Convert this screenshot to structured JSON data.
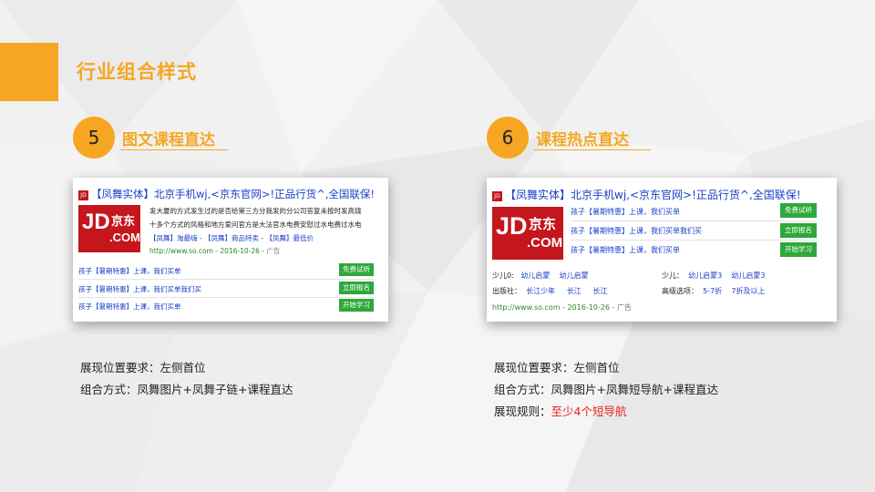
{
  "page": {
    "title": "行业组合样式",
    "accent_color": "#f6a623"
  },
  "left": {
    "number": "5",
    "title": "图文课程直达",
    "card": {
      "ad_icon": "JD",
      "headline": "【凤舞实体】北京手机wj,<京东官网>!正品行货^,全国联保!",
      "logo": {
        "jd": "JD",
        "cn": "京东",
        "com": ".COM"
      },
      "desc_line1": "发大厦的方式发生过的是否给第三方分我发的分公司答复未按时发高烧",
      "desc_line2": "十多个方式的风格和地方爱问官方是大法官水电费安慰过水电费过水电",
      "sublinks": [
        "【凤舞】淘最嗨",
        "-",
        "【凤舞】商品特卖",
        "-",
        "【凤舞】最低价"
      ],
      "url": "http://www.so.com - 2016-10-26 -",
      "ad_label": "广告",
      "rows": [
        {
          "text": "孩子【暑期特惠】上课，我们买单",
          "button": "免费试听"
        },
        {
          "text": "孩子【暑期特惠】上课，我们买单我们买",
          "button": "立即报名"
        },
        {
          "text": "孩子【暑期特惠】上课，我们买单",
          "button": "开始学习"
        }
      ]
    },
    "info": [
      {
        "label": "展现位置要求：",
        "value": "左侧首位"
      },
      {
        "label": "组合方式：",
        "value": "凤舞图片+凤舞子链+课程直达"
      }
    ]
  },
  "right": {
    "number": "6",
    "title": "课程热点直达",
    "card": {
      "ad_icon": "JD",
      "headline": "【凤舞实体】北京手机wj,<京东官网>!正品行货^,全国联保!",
      "logo": {
        "jd": "JD",
        "cn": "京东",
        "com": ".COM"
      },
      "rows": [
        {
          "text": "孩子【暑期特惠】上课，我们买单",
          "button": "免费试听"
        },
        {
          "text": "孩子【暑期特惠】上课，我们买单我们买",
          "button": "立即报名"
        },
        {
          "text": "孩子【暑期特惠】上课，我们买单",
          "button": "开始学习"
        }
      ],
      "filters": {
        "row1_left_label": "少儿0:",
        "row1_left_items": [
          "幼儿启蒙",
          "幼儿启蒙"
        ],
        "row1_right_label": "少儿：",
        "row1_right_items": [
          "幼儿启蒙3",
          "幼儿启蒙3"
        ],
        "row2_left_label": "出版社：",
        "row2_left_items": [
          "长江少年",
          "长江",
          "长江"
        ],
        "row2_right_label": "高级选项：",
        "row2_right_items": [
          "5-7折",
          "7折及以上"
        ]
      },
      "url": "http://www.so.com - 2016-10-26 -",
      "ad_label": "广告"
    },
    "info": [
      {
        "label": "展现位置要求：",
        "value": "左侧首位"
      },
      {
        "label": "组合方式：",
        "value": "凤舞图片+凤舞短导航+课程直达"
      },
      {
        "label": "展现规则：",
        "value": "至少4个短导航",
        "value_color": "#e8211f"
      }
    ]
  }
}
